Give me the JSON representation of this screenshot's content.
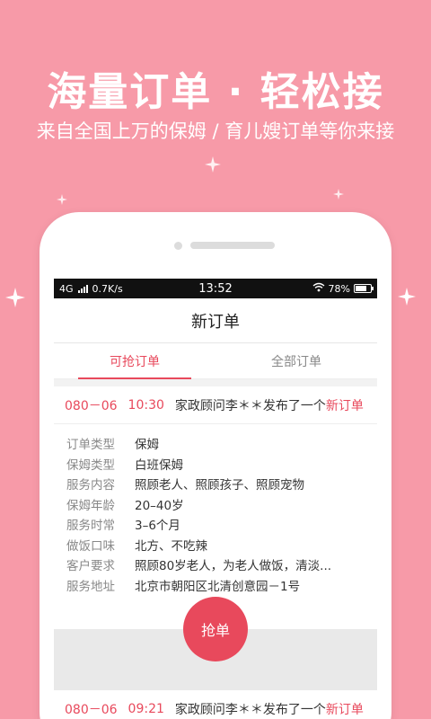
{
  "promo": {
    "title": "海量订单 · 轻松接",
    "subtitle": "来自全国上万的保姆 / 育儿嫂订单等你来接"
  },
  "status_bar": {
    "network": "4G",
    "speed": "0.7K/s",
    "time": "13:52",
    "battery": "78%",
    "battery_level": 0.78
  },
  "header": {
    "title": "新订单"
  },
  "tabs": [
    {
      "label": "可抢订单",
      "active": true
    },
    {
      "label": "全部订单",
      "active": false
    }
  ],
  "orders": [
    {
      "date": "080－06",
      "time": "10:30",
      "message": "家政顾问李＊＊发布了一个",
      "highlight": "新订单",
      "details": [
        {
          "label": "订单类型",
          "value": "保姆"
        },
        {
          "label": "保姆类型",
          "value": "白班保姆"
        },
        {
          "label": "服务内容",
          "value": "照顾老人、照顾孩子、照顾宠物"
        },
        {
          "label": "保姆年龄",
          "value": "20–40岁"
        },
        {
          "label": "服务时常",
          "value": "3–6个月"
        },
        {
          "label": "做饭口味",
          "value": "北方、不吃辣"
        },
        {
          "label": "客户要求",
          "value": "照顾80岁老人，为老人做饭，清淡..."
        },
        {
          "label": "服务地址",
          "value": "北京市朝阳区北清创意园－1号"
        }
      ],
      "action": "抢单"
    },
    {
      "date": "080－06",
      "time": "09:21",
      "message": "家政顾问李＊＊发布了一个",
      "highlight": "新订单"
    }
  ],
  "colors": {
    "background": "#f79aa8",
    "accent": "#e8495c"
  }
}
